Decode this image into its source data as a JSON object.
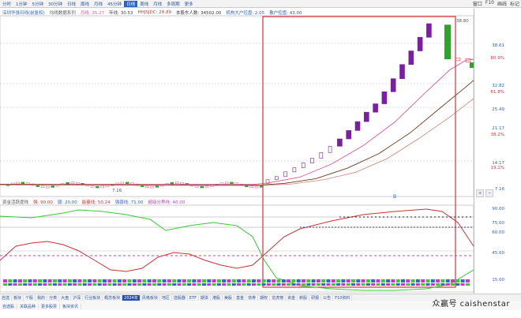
{
  "toolbar": {
    "periods": [
      {
        "label": "分时",
        "active": false
      },
      {
        "label": "1分钟",
        "active": false
      },
      {
        "label": "5分钟",
        "active": false
      },
      {
        "label": "30分钟",
        "active": false
      },
      {
        "label": "日线",
        "active": false
      },
      {
        "label": "周线",
        "active": false
      },
      {
        "label": "月线",
        "active": false
      },
      {
        "label": "45分钟",
        "active": false
      },
      {
        "label": "日线",
        "active": true
      },
      {
        "label": "周线",
        "active": false
      },
      {
        "label": "月线",
        "active": false
      },
      {
        "label": "多周期",
        "active": false
      },
      {
        "label": "更多",
        "active": false
      }
    ],
    "right_items": [
      "窗口",
      "F10",
      "画线",
      "标记"
    ]
  },
  "indicator_bar": {
    "title": "深圳华强日线(前复权)",
    "items": [
      {
        "label": "均线数据系列",
        "color": "#555555"
      },
      {
        "label": "月线: 35.27",
        "color": "#e05599"
      },
      {
        "label": "年线: 30.53",
        "color": "#444444"
      },
      {
        "label": "HHJSJDC: 28.89",
        "color": "#c04040"
      },
      {
        "label": "本股东人数: 34502.00",
        "color": "#333333"
      },
      {
        "label": "机构大户控盘: 2.05",
        "color": "#2a62c9"
      },
      {
        "label": "散户控盘: 43.00",
        "color": "#2a62c9"
      }
    ]
  },
  "sub_indicator_bar": {
    "items": [
      {
        "label": "资金活跃度线",
        "color": "#555555"
      },
      {
        "label": "强: 90.00",
        "color": "#d03030"
      },
      {
        "label": "弱: 20.00",
        "color": "#2a62c9"
      },
      {
        "label": "能量线: 50.24",
        "color": "#d03030"
      },
      {
        "label": "强弱线: 71.00",
        "color": "#2a62c9"
      },
      {
        "label": "超级分界线: 40.00",
        "color": "#c040c0"
      }
    ]
  },
  "price_axis": [
    "38.61",
    "80.9%",
    "32.82",
    "61.8%",
    "25.49",
    "21.17",
    "38.2%",
    "14.17",
    "19.1%",
    "7.16"
  ],
  "sub_axis": [
    "90.00",
    "75.00",
    "60.00",
    "45.00",
    "15.00"
  ],
  "labels": {
    "high_price": "38.80",
    "low_price": "7.16",
    "year": "2024年",
    "buy_marker": "B"
  },
  "colors": {
    "up": "#7a1fa2",
    "down": "#2aa52a",
    "ma_pink": "#e05599",
    "ma_brown": "#6b3a1a",
    "ma_red": "#d08070",
    "highlight_box": "#e0303a",
    "energy": "#d03030",
    "strength": "#33cc33",
    "dash_purple": "#c040c0"
  },
  "bottom_tabs": [
    "自选",
    "板块",
    "个股",
    "我的",
    "分类",
    "大盘",
    "沪深",
    "行业板块",
    "概念板块",
    "2024年",
    "风格板块",
    "地区",
    "选股器",
    "ETF",
    "期货",
    "港股",
    "美股",
    "基金",
    "债券",
    "期权",
    "龙虎榜",
    "资金",
    "新股",
    "研报",
    "公告",
    "F10资料"
  ],
  "bottom_tabs2": [
    "自选股",
    "关联品种",
    "更多股票",
    "板块资讯"
  ],
  "watermark": "众赢号 caishenstar"
}
